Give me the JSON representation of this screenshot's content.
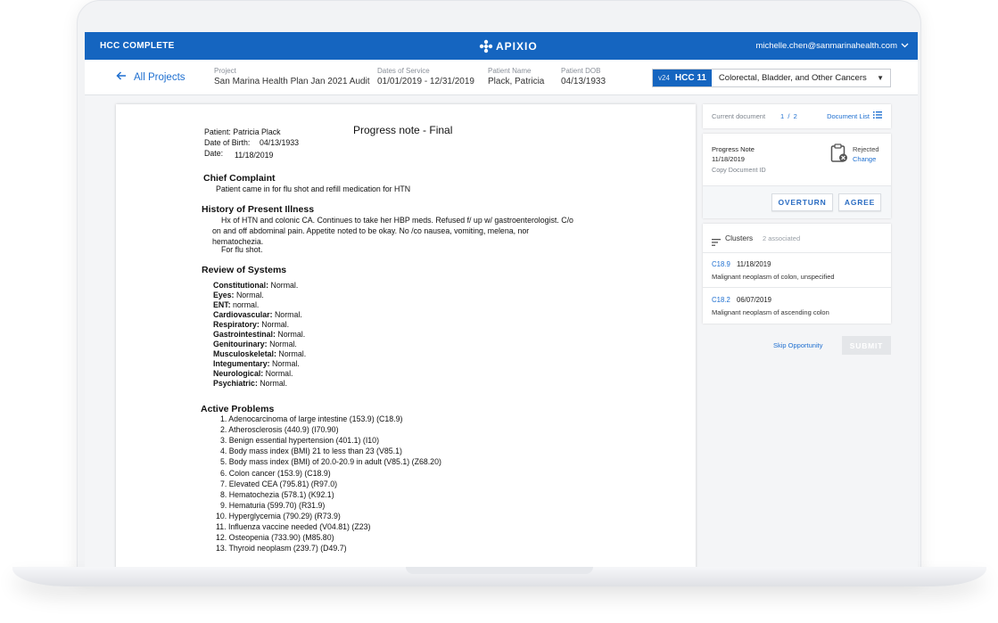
{
  "topbar": {
    "app_title": "HCC COMPLETE",
    "logo_text": "APIXIO",
    "user_email": "michelle.chen@sanmarinahealth.com"
  },
  "context": {
    "back_label": "All Projects",
    "project_label": "Project",
    "project_value": "San Marina Health Plan Jan 2021 Audit",
    "dos_label": "Dates of Service",
    "dos_value": "01/01/2019 - 12/31/2019",
    "patient_label": "Patient Name",
    "patient_value": "Plack, Patricia",
    "dob_label": "Patient DOB",
    "dob_value": "04/13/1933",
    "hcc_version": "v24",
    "hcc_code": "HCC 11",
    "hcc_name": "Colorectal, Bladder, and Other Cancers"
  },
  "document": {
    "patient_line": "Patient: Patricia Plack",
    "dob_label": "Date of Birth:",
    "dob_value": "04/13/1933",
    "date_label": "Date:",
    "date_value": "11/18/2019",
    "title": "Progress note  - Final",
    "chief_complaint_heading": "Chief Complaint",
    "chief_complaint_text": "Patient came in for flu shot and refill medication for HTN",
    "hpi_heading": "History of Present Illness",
    "hpi_line1": "Hx of HTN and colonic CA. Continues to take her HBP meds. Refused f/ up w/ gastroenterologist. C/o",
    "hpi_line2": "on and off abdominal pain. Appetite noted to be okay. No /co nausea, vomiting, melena, nor",
    "hpi_line3": "hematochezia.",
    "hpi_line4": "For flu shot.",
    "ros_heading": "Review of Systems",
    "ros": [
      {
        "label": "Constitutional:",
        "value": "Normal."
      },
      {
        "label": "Eyes:",
        "value": "Normal."
      },
      {
        "label": "ENT:",
        "value": "normal."
      },
      {
        "label": "Cardiovascular:",
        "value": "Normal."
      },
      {
        "label": "Respiratory:",
        "value": "Normal."
      },
      {
        "label": "Gastrointestinal:",
        "value": "Normal."
      },
      {
        "label": "Genitourinary:",
        "value": "Normal."
      },
      {
        "label": "Musculoskeletal:",
        "value": "Normal."
      },
      {
        "label": "Integumentary:",
        "value": "Normal."
      },
      {
        "label": "Neurological:",
        "value": "Normal."
      },
      {
        "label": "Psychiatric:",
        "value": "Normal."
      }
    ],
    "problems_heading": "Active Problems",
    "problems": [
      "1. Adenocarcinoma of large intestine (153.9) (C18.9)",
      "2. Atherosclerosis (440.9) (I70.90)",
      "3. Benign essential hypertension (401.1) (I10)",
      "4. Body mass index (BMI) 21 to less than 23 (V85.1)",
      "5. Body mass index (BMI) of 20.0-20.9 in adult (V85.1) (Z68.20)",
      "6. Colon cancer (153.9) (C18.9)",
      "7. Elevated CEA (795.81) (R97.0)",
      "8. Hematochezia (578.1) (K92.1)",
      "9. Hematuria (599.70) (R31.9)",
      "10. Hyperglycemia (790.29) (R73.9)",
      "11. Influenza vaccine needed (V04.81) (Z23)",
      "12. Osteopenia (733.90) (M85.80)",
      "13. Thyroid neoplasm (239.7) (D49.7)"
    ]
  },
  "sidebar": {
    "current_label": "Current document",
    "current_index": "1",
    "current_total": "2",
    "document_list": "Document List",
    "note_type": "Progress Note",
    "note_date": "11/18/2019",
    "copy_id": "Copy Document ID",
    "status": "Rejected",
    "change": "Change",
    "overturn": "OVERTURN",
    "agree": "AGREE",
    "clusters_label": "Clusters",
    "clusters_count": "2 associated",
    "clusters": [
      {
        "code": "C18.9",
        "date": "11/18/2019",
        "desc": "Malignant neoplasm of colon, unspecified"
      },
      {
        "code": "C18.2",
        "date": "06/07/2019",
        "desc": "Malignant neoplasm of ascending colon"
      }
    ],
    "skip": "Skip Opportunity",
    "submit": "SUBMIT"
  },
  "colors": {
    "brand_blue": "#1565c0",
    "link_blue": "#1e6fd0"
  },
  "icons": [
    "back-arrow-icon",
    "apixio-logo-icon",
    "chevron-down-icon",
    "list-icon",
    "clipboard-rejected-icon",
    "filter-lines-icon"
  ]
}
